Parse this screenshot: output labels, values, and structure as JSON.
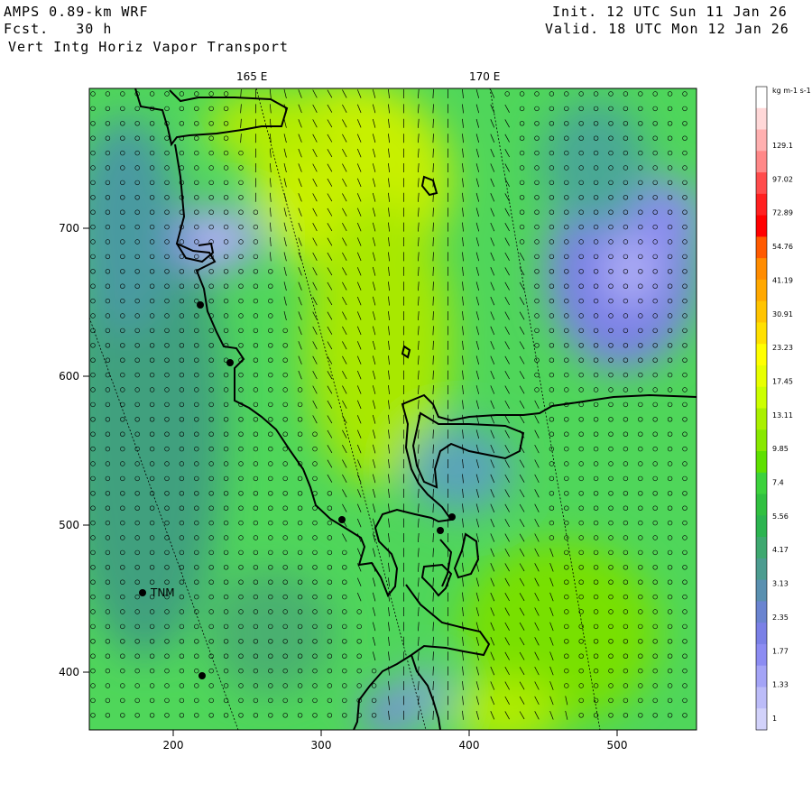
{
  "header": {
    "model": "AMPS 0.89-km WRF",
    "forecast": "Fcst.   30 h",
    "field": "Vert Intg Horiz Vapor Transport",
    "init": "Init. 12 UTC Sun 11 Jan 26",
    "valid": "Valid. 18 UTC Mon 12 Jan 26"
  },
  "map": {
    "lon_labels": [
      "165 E",
      "170 E"
    ],
    "x_ticks": [
      "200",
      "300",
      "400",
      "500"
    ],
    "y_ticks": [
      "700",
      "600",
      "500",
      "400"
    ],
    "station_label": "TNM"
  },
  "colorbar": {
    "units": "kg m-1 s-1",
    "labels": [
      "129.1",
      "97.02",
      "72.89",
      "54.76",
      "41.19",
      "30.91",
      "23.23",
      "17.45",
      "13.11",
      "9.85",
      "7.4",
      "5.56",
      "4.17",
      "3.13",
      "2.35",
      "1.77",
      "1.33",
      "1"
    ],
    "colors": [
      "#ffffff",
      "#ffd8d8",
      "#ffb0b0",
      "#ff8888",
      "#ff4c4c",
      "#ff2020",
      "#ff0000",
      "#ff5a00",
      "#ff8c00",
      "#ffa800",
      "#ffc400",
      "#ffe000",
      "#ffff00",
      "#e8ff00",
      "#ccff00",
      "#aaf000",
      "#88e800",
      "#5ee000",
      "#3cd23c",
      "#30c040",
      "#2cb450",
      "#3ea870",
      "#4c9c90",
      "#5a90b0",
      "#6a84d0",
      "#7a80e6",
      "#8c8cf2",
      "#a4a4f6",
      "#bcbcf8",
      "#d2d2fa"
    ]
  }
}
